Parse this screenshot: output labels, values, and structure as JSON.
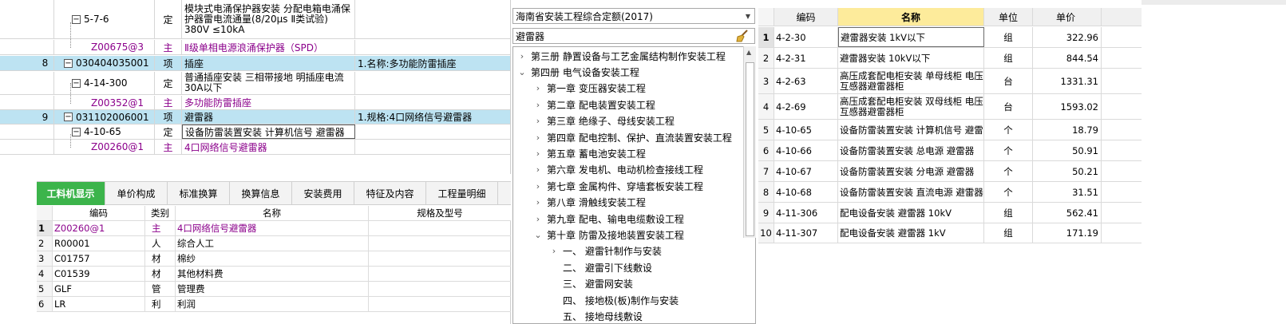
{
  "top_table": {
    "rows": [
      {
        "idx": "",
        "code": "5-7-6",
        "type": "定",
        "name": "模块式电涌保护器安装 分配电箱电涌保护器雷电流通量(8/20μs Ⅱ类试验) 380V ≤10kA",
        "feature": ""
      },
      {
        "idx": "",
        "code": "Z00675@3",
        "type": "主",
        "name": "Ⅱ级单相电源浪涌保护器（SPD）",
        "feature": ""
      },
      {
        "idx": "8",
        "code": "030404035001",
        "type": "项",
        "name": "插座",
        "feature": "1.名称:多功能防雷插座"
      },
      {
        "idx": "",
        "code": "4-14-300",
        "type": "定",
        "name": "普通插座安装 三相带接地 明插座电流30A以下",
        "feature": ""
      },
      {
        "idx": "",
        "code": "Z00352@1",
        "type": "主",
        "name": "多功能防雷插座",
        "feature": ""
      },
      {
        "idx": "9",
        "code": "031102006001",
        "type": "项",
        "name": "避雷器",
        "feature": "1.规格:4口网络信号避雷器"
      },
      {
        "idx": "",
        "code": "4-10-65",
        "type": "定",
        "name": "设备防雷装置安装 计算机信号 避雷器",
        "feature": ""
      },
      {
        "idx": "",
        "code": "Z00260@1",
        "type": "主",
        "name": "4口网络信号避雷器",
        "feature": ""
      }
    ]
  },
  "tabs": [
    "工料机显示",
    "单价构成",
    "标准换算",
    "换算信息",
    "安装费用",
    "特征及内容",
    "工程量明细"
  ],
  "materials": {
    "headers": {
      "code": "编码",
      "category": "类别",
      "name": "名称",
      "spec": "规格及型号"
    },
    "rows": [
      {
        "idx": "1",
        "code": "Z00260@1",
        "category": "主",
        "name": "4口网络信号避雷器"
      },
      {
        "idx": "2",
        "code": "R00001",
        "category": "人",
        "name": "综合人工"
      },
      {
        "idx": "3",
        "code": "C01757",
        "category": "材",
        "name": "棉纱"
      },
      {
        "idx": "4",
        "code": "C01539",
        "category": "材",
        "name": "其他材料费"
      },
      {
        "idx": "5",
        "code": "GLF",
        "category": "管",
        "name": "管理费"
      },
      {
        "idx": "6",
        "code": "LR",
        "category": "利",
        "name": "利润"
      }
    ]
  },
  "library": {
    "selected": "海南省安装工程综合定额(2017)",
    "search_value": "避雷器"
  },
  "tree": [
    {
      "label": "第三册  静置设备与工艺金属结构制作安装工程",
      "chevron": "›",
      "level": 0
    },
    {
      "label": "第四册  电气设备安装工程",
      "chevron": "⌄",
      "level": 0
    },
    {
      "label": "第一章  变压器安装工程",
      "chevron": "›",
      "level": 1
    },
    {
      "label": "第二章  配电装置安装工程",
      "chevron": "›",
      "level": 1
    },
    {
      "label": "第三章  绝缘子、母线安装工程",
      "chevron": "›",
      "level": 1
    },
    {
      "label": "第四章  配电控制、保护、直流装置安装工程",
      "chevron": "›",
      "level": 1
    },
    {
      "label": "第五章  蓄电池安装工程",
      "chevron": "›",
      "level": 1
    },
    {
      "label": "第六章  发电机、电动机检查接线工程",
      "chevron": "›",
      "level": 1
    },
    {
      "label": "第七章  金属构件、穿墙套板安装工程",
      "chevron": "›",
      "level": 1
    },
    {
      "label": "第八章  滑触线安装工程",
      "chevron": "›",
      "level": 1
    },
    {
      "label": "第九章  配电、输电电缆敷设工程",
      "chevron": "›",
      "level": 1
    },
    {
      "label": "第十章  防雷及接地装置安装工程",
      "chevron": "⌄",
      "level": 1
    },
    {
      "label": "一、  避雷针制作与安装",
      "chevron": "›",
      "level": 2
    },
    {
      "label": "二、  避雷引下线敷设",
      "chevron": "",
      "level": 2
    },
    {
      "label": "三、  避雷网安装",
      "chevron": "",
      "level": 2
    },
    {
      "label": "四、  接地极(板)制作与安装",
      "chevron": "",
      "level": 2
    },
    {
      "label": "五、  接地母线敷设",
      "chevron": "",
      "level": 2
    }
  ],
  "quota": {
    "headers": {
      "code": "编码",
      "name": "名称",
      "unit": "单位",
      "price": "单价"
    },
    "rows": [
      {
        "idx": "1",
        "code": "4-2-30",
        "name": "避雷器安装 1kV以下",
        "unit": "组",
        "price": "322.96"
      },
      {
        "idx": "2",
        "code": "4-2-31",
        "name": "避雷器安装 10kV以下",
        "unit": "组",
        "price": "844.54"
      },
      {
        "idx": "3",
        "code": "4-2-63",
        "name": "高压成套配电柜安装 单母线柜 电压互感器避雷器柜",
        "unit": "台",
        "price": "1331.31"
      },
      {
        "idx": "4",
        "code": "4-2-69",
        "name": "高压成套配电柜安装 双母线柜 电压互感器避雷器柜",
        "unit": "台",
        "price": "1593.02"
      },
      {
        "idx": "5",
        "code": "4-10-65",
        "name": "设备防雷装置安装 计算机信号 避雷器",
        "unit": "个",
        "price": "18.79"
      },
      {
        "idx": "6",
        "code": "4-10-66",
        "name": "设备防雷装置安装 总电源 避雷器",
        "unit": "个",
        "price": "50.91"
      },
      {
        "idx": "7",
        "code": "4-10-67",
        "name": "设备防雷装置安装 分电源 避雷器",
        "unit": "个",
        "price": "50.21"
      },
      {
        "idx": "8",
        "code": "4-10-68",
        "name": "设备防雷装置安装 直流电源 避雷器",
        "unit": "个",
        "price": "31.51"
      },
      {
        "idx": "9",
        "code": "4-11-306",
        "name": "配电设备安装 避雷器 10kV",
        "unit": "组",
        "price": "562.41"
      },
      {
        "idx": "10",
        "code": "4-11-307",
        "name": "配电设备安装 避雷器 1kV",
        "unit": "组",
        "price": "171.19"
      }
    ]
  }
}
